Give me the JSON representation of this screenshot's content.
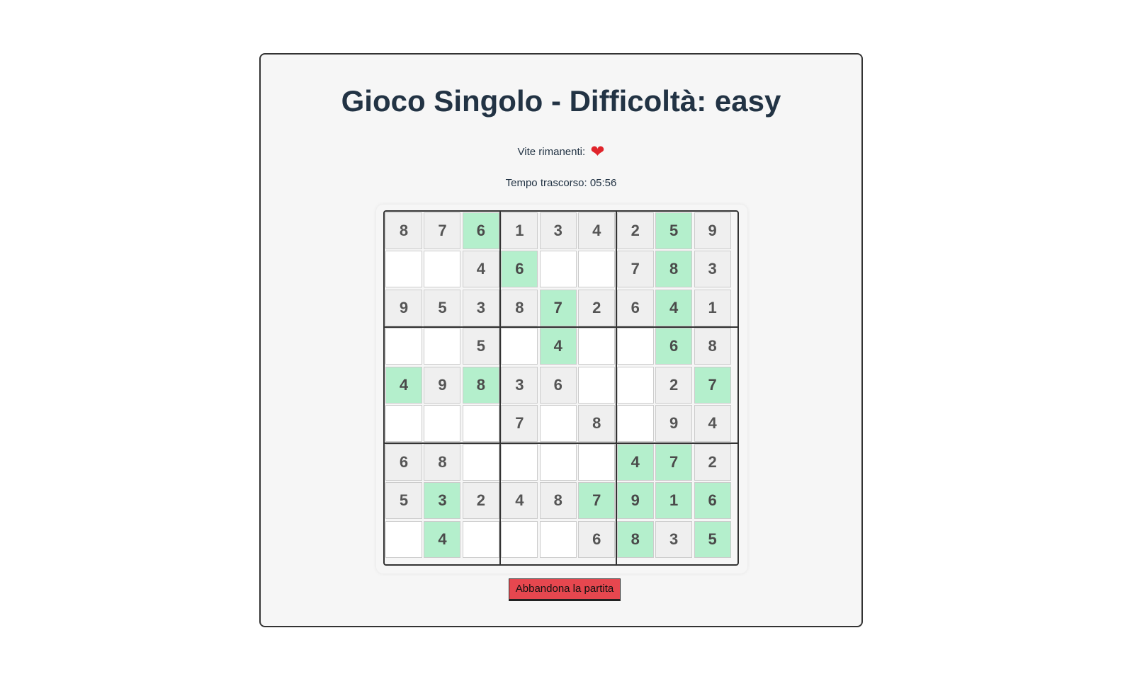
{
  "header": {
    "title": "Gioco Singolo - Difficoltà: easy"
  },
  "status": {
    "lives_label": "Vite rimanenti:",
    "lives_icon": "heart-icon",
    "lives_count": 1,
    "time_label": "Tempo trascorso: 05:56"
  },
  "board": {
    "cells": [
      [
        {
          "v": "8",
          "s": "given"
        },
        {
          "v": "7",
          "s": "given"
        },
        {
          "v": "6",
          "s": "solved"
        },
        {
          "v": "1",
          "s": "given"
        },
        {
          "v": "3",
          "s": "given"
        },
        {
          "v": "4",
          "s": "given"
        },
        {
          "v": "2",
          "s": "given"
        },
        {
          "v": "5",
          "s": "solved"
        },
        {
          "v": "9",
          "s": "given"
        }
      ],
      [
        {
          "v": "",
          "s": "empty"
        },
        {
          "v": "",
          "s": "empty"
        },
        {
          "v": "4",
          "s": "given"
        },
        {
          "v": "6",
          "s": "solved"
        },
        {
          "v": "",
          "s": "empty"
        },
        {
          "v": "",
          "s": "empty"
        },
        {
          "v": "7",
          "s": "given"
        },
        {
          "v": "8",
          "s": "solved"
        },
        {
          "v": "3",
          "s": "given"
        }
      ],
      [
        {
          "v": "9",
          "s": "given"
        },
        {
          "v": "5",
          "s": "given"
        },
        {
          "v": "3",
          "s": "given"
        },
        {
          "v": "8",
          "s": "given"
        },
        {
          "v": "7",
          "s": "solved"
        },
        {
          "v": "2",
          "s": "given"
        },
        {
          "v": "6",
          "s": "given"
        },
        {
          "v": "4",
          "s": "solved"
        },
        {
          "v": "1",
          "s": "given"
        }
      ],
      [
        {
          "v": "",
          "s": "empty"
        },
        {
          "v": "",
          "s": "empty"
        },
        {
          "v": "5",
          "s": "given"
        },
        {
          "v": "",
          "s": "empty"
        },
        {
          "v": "4",
          "s": "solved"
        },
        {
          "v": "",
          "s": "empty"
        },
        {
          "v": "",
          "s": "empty"
        },
        {
          "v": "6",
          "s": "solved"
        },
        {
          "v": "8",
          "s": "given"
        }
      ],
      [
        {
          "v": "4",
          "s": "solved"
        },
        {
          "v": "9",
          "s": "given"
        },
        {
          "v": "8",
          "s": "solved"
        },
        {
          "v": "3",
          "s": "given"
        },
        {
          "v": "6",
          "s": "given"
        },
        {
          "v": "",
          "s": "empty"
        },
        {
          "v": "",
          "s": "empty"
        },
        {
          "v": "2",
          "s": "given"
        },
        {
          "v": "7",
          "s": "solved"
        }
      ],
      [
        {
          "v": "",
          "s": "empty"
        },
        {
          "v": "",
          "s": "empty"
        },
        {
          "v": "",
          "s": "empty"
        },
        {
          "v": "7",
          "s": "given"
        },
        {
          "v": "",
          "s": "empty"
        },
        {
          "v": "8",
          "s": "given"
        },
        {
          "v": "",
          "s": "empty"
        },
        {
          "v": "9",
          "s": "given"
        },
        {
          "v": "4",
          "s": "given"
        }
      ],
      [
        {
          "v": "6",
          "s": "given"
        },
        {
          "v": "8",
          "s": "given"
        },
        {
          "v": "",
          "s": "empty"
        },
        {
          "v": "",
          "s": "empty"
        },
        {
          "v": "",
          "s": "empty"
        },
        {
          "v": "",
          "s": "empty"
        },
        {
          "v": "4",
          "s": "solved"
        },
        {
          "v": "7",
          "s": "solved"
        },
        {
          "v": "2",
          "s": "given"
        }
      ],
      [
        {
          "v": "5",
          "s": "given"
        },
        {
          "v": "3",
          "s": "solved"
        },
        {
          "v": "2",
          "s": "given"
        },
        {
          "v": "4",
          "s": "given"
        },
        {
          "v": "8",
          "s": "given"
        },
        {
          "v": "7",
          "s": "solved"
        },
        {
          "v": "9",
          "s": "solved"
        },
        {
          "v": "1",
          "s": "solved"
        },
        {
          "v": "6",
          "s": "solved"
        }
      ],
      [
        {
          "v": "",
          "s": "empty"
        },
        {
          "v": "4",
          "s": "solved"
        },
        {
          "v": "",
          "s": "empty"
        },
        {
          "v": "",
          "s": "empty"
        },
        {
          "v": "",
          "s": "empty"
        },
        {
          "v": "6",
          "s": "given"
        },
        {
          "v": "8",
          "s": "solved"
        },
        {
          "v": "3",
          "s": "given"
        },
        {
          "v": "5",
          "s": "solved"
        }
      ]
    ]
  },
  "actions": {
    "quit_label": "Abbandona la partita"
  },
  "colors": {
    "solved_cell": "#b4efcc",
    "given_cell": "#efefef",
    "empty_cell": "#ffffff",
    "quit_button": "#e6474f",
    "title_text": "#223344"
  }
}
